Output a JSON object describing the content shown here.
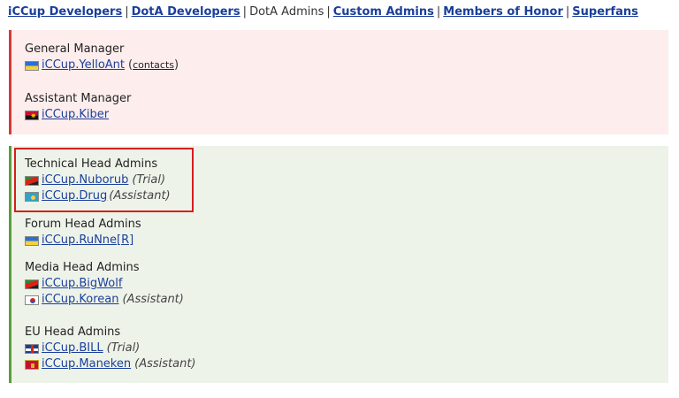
{
  "nav": {
    "items": [
      {
        "label": "iCCup Developers",
        "link": true
      },
      {
        "label": "DotA Developers",
        "link": true
      },
      {
        "label": "DotA Admins",
        "link": false
      },
      {
        "label": "Custom Admins",
        "link": true
      },
      {
        "label": "Members of Honor",
        "link": true
      },
      {
        "label": "Superfans",
        "link": true
      }
    ],
    "separator": "|"
  },
  "management": {
    "general_manager": {
      "title": "General Manager",
      "members": [
        {
          "flag": "ua",
          "name": "iCCup.YelloAnt",
          "extra_link": "contacts"
        }
      ]
    },
    "assistant_manager": {
      "title": "Assistant Manager",
      "members": [
        {
          "flag": "ao",
          "name": "iCCup.Kiber"
        }
      ]
    }
  },
  "heads": {
    "technical": {
      "title": "Technical Head Admins",
      "members": [
        {
          "flag": "sr",
          "name": "iCCup.Nuborub",
          "note": "(Trial)"
        },
        {
          "flag": "kz",
          "name": "iCCup.Drug",
          "note": "(Assistant)"
        }
      ]
    },
    "forum": {
      "title": "Forum Head Admins",
      "members": [
        {
          "flag": "ua",
          "name": "iCCup.RuNne[R]"
        }
      ]
    },
    "media": {
      "title": "Media Head Admins",
      "members": [
        {
          "flag": "sr",
          "name": "iCCup.BigWolf"
        },
        {
          "flag": "kr",
          "name": "iCCup.Korean",
          "note": "(Assistant)"
        }
      ]
    },
    "eu": {
      "title": "EU Head Admins",
      "members": [
        {
          "flag": "gb",
          "name": "iCCup.BILL",
          "note": "(Trial)"
        },
        {
          "flag": "me",
          "name": "iCCup.Maneken",
          "note": "(Assistant)"
        }
      ]
    }
  },
  "colors": {
    "link": "#1a3f9b",
    "red_panel_bg": "#fdeded",
    "red_panel_border": "#d73a3a",
    "green_panel_bg": "#eef3ea",
    "green_panel_border": "#5a9e3c",
    "highlight": "#d61e1e"
  }
}
